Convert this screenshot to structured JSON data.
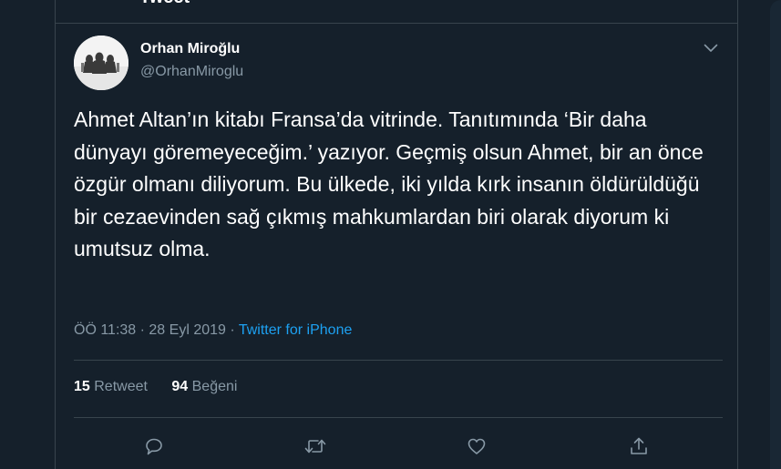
{
  "header": {
    "title": "Tweet"
  },
  "tweet": {
    "author_name": "Orhan Miroğlu",
    "author_handle": "@OrhanMiroglu",
    "text": "Ahmet Altan’ın kitabı Fransa’da vitrinde. Tanıtımında ‘Bir daha dünyayı göremeyeceğim.’ yazıyor. Geçmiş olsun Ahmet, bir an önce özgür olmanı diliyorum. Bu ülkede, iki yılda kırk insanın öldürüldüğü bir cezaevinden sağ çıkmış mahkumlardan biri olarak diyorum ki umutsuz olma.",
    "time": "ÖÖ 11:38",
    "separator": " · ",
    "date": "28 Eyl 2019",
    "source": "Twitter for iPhone"
  },
  "stats": {
    "retweet_count": "15",
    "retweet_label": " Retweet",
    "like_count": "94",
    "like_label": " Beğeni"
  },
  "icons": {
    "more": "chevron-down-icon",
    "reply": "reply-icon",
    "retweet": "retweet-icon",
    "like": "heart-icon",
    "share": "share-icon"
  },
  "colors": {
    "background": "#15202b",
    "border": "#38444d",
    "secondary_text": "#8899a6",
    "accent": "#1da1f2"
  }
}
